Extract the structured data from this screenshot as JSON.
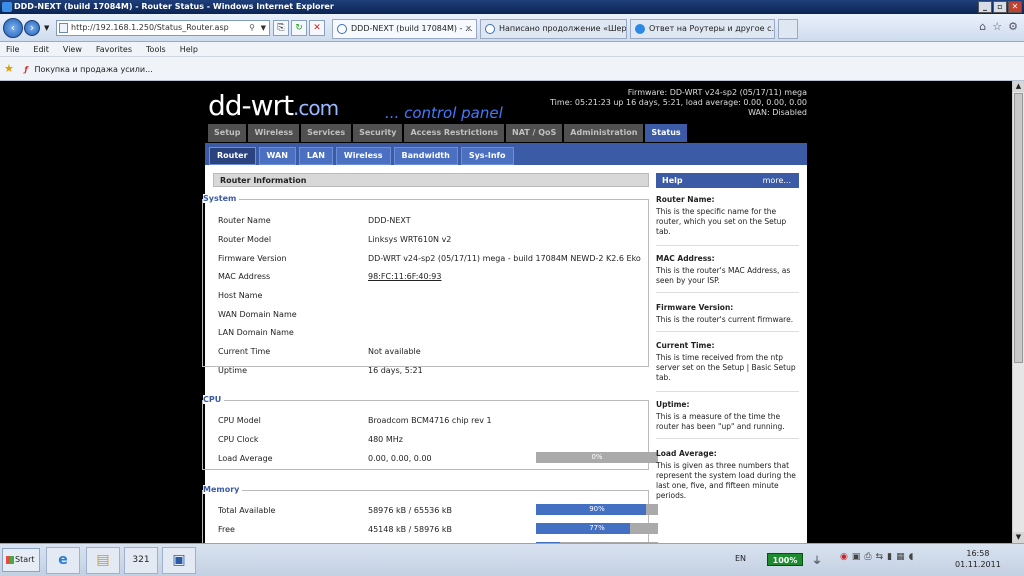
{
  "window": {
    "title": "DDD-NEXT (build 17084M) - Router Status - Windows Internet Explorer",
    "controls": {
      "minimize": "_",
      "maximize": "▫",
      "close": "✕"
    }
  },
  "browser": {
    "address": "http://192.168.1.250/Status_Router.asp",
    "tabs": [
      {
        "label": "DDD-NEXT (build 17084M) - ...",
        "active": true,
        "close": "✕"
      },
      {
        "label": "Написано продолжение «Шер...",
        "active": false
      },
      {
        "label": "Ответ на Роутеры и другое с...",
        "active": false
      }
    ],
    "menu": [
      "File",
      "Edit",
      "View",
      "Favorites",
      "Tools",
      "Help"
    ],
    "favorites_item": "Покупка и продажа усили..."
  },
  "router": {
    "logo": "dd-wrt",
    "logo_com": ".com",
    "subtitle": "... control panel",
    "firmware_line": "Firmware: DD-WRT v24-sp2 (05/17/11) mega",
    "time_line": "Time: 05:21:23 up 16 days, 5:21, load average: 0.00, 0.00, 0.00",
    "wan_line": "WAN: Disabled",
    "tabs": [
      "Setup",
      "Wireless",
      "Services",
      "Security",
      "Access Restrictions",
      "NAT / QoS",
      "Administration",
      "Status"
    ],
    "subtabs": [
      "Router",
      "WAN",
      "LAN",
      "Wireless",
      "Bandwidth",
      "Sys-Info"
    ],
    "section_title": "Router Information",
    "system": {
      "legend": "System",
      "rows": [
        {
          "label": "Router Name",
          "value": "DDD-NEXT"
        },
        {
          "label": "Router Model",
          "value": "Linksys WRT610N v2"
        },
        {
          "label": "Firmware Version",
          "value": "DD-WRT v24-sp2 (05/17/11) mega - build 17084M NEWD-2 K2.6 Eko"
        },
        {
          "label": "MAC Address",
          "value": "98:FC:11:6F:40:93"
        },
        {
          "label": "Host Name",
          "value": ""
        },
        {
          "label": "WAN Domain Name",
          "value": ""
        },
        {
          "label": "LAN Domain Name",
          "value": ""
        },
        {
          "label": "Current Time",
          "value": "Not available"
        },
        {
          "label": "Uptime",
          "value": "16 days, 5:21"
        }
      ]
    },
    "cpu": {
      "legend": "CPU",
      "rows": [
        {
          "label": "CPU Model",
          "value": "Broadcom BCM4716 chip rev 1"
        },
        {
          "label": "CPU Clock",
          "value": "480 MHz"
        },
        {
          "label": "Load Average",
          "value": "0.00, 0.00, 0.00",
          "bar_text": "0%",
          "bar_fraction": 0
        }
      ]
    },
    "memory": {
      "legend": "Memory",
      "rows": [
        {
          "label": "Total Available",
          "value": "58976 kB / 65536 kB",
          "bar_text": "90%",
          "bar_fraction": 0.9
        },
        {
          "label": "Free",
          "value": "45148 kB / 58976 kB",
          "bar_text": "77%",
          "bar_fraction": 0.77
        }
      ]
    },
    "help": {
      "title": "Help",
      "more": "more...",
      "items": [
        {
          "title": "Router Name:",
          "text": "This is the specific name for the router, which you set on the Setup tab."
        },
        {
          "title": "MAC Address:",
          "text": "This is the router's MAC Address, as seen by your ISP."
        },
        {
          "title": "Firmware Version:",
          "text": "This is the router's current firmware."
        },
        {
          "title": "Current Time:",
          "text": "This is time received from the ntp server set on the Setup | Basic Setup tab."
        },
        {
          "title": "Uptime:",
          "text": "This is a measure of the time the router has been \"up\" and running."
        },
        {
          "title": "Load Average:",
          "text": "This is given as three numbers that represent the system load during the last one, five, and fifteen minute periods."
        }
      ]
    }
  },
  "taskbar": {
    "start": "Start",
    "lang": "EN",
    "battery": "100%",
    "clock_time": "16:58",
    "clock_date": "01.11.2011"
  }
}
